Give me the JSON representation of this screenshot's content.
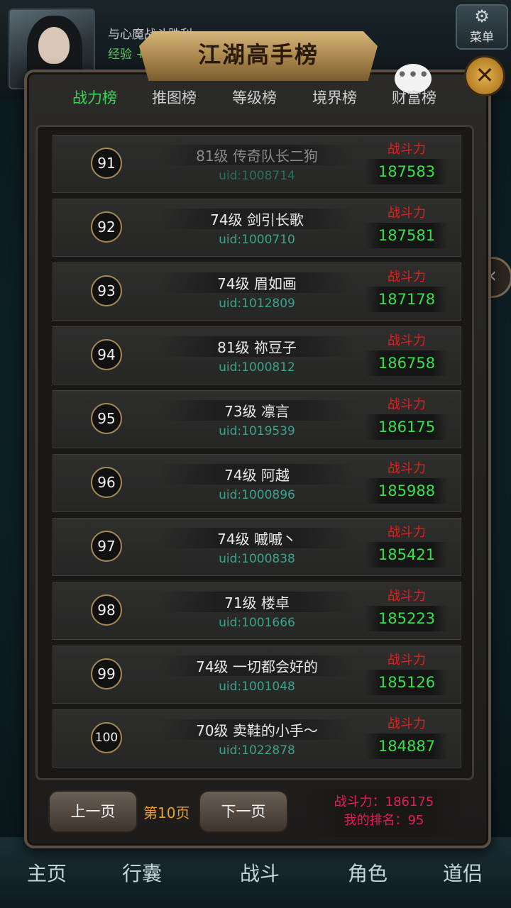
{
  "header": {
    "status": "与心魔战斗胜利",
    "exp": "经验 +",
    "menu_label": "菜单"
  },
  "panel": {
    "title": "江湖高手榜",
    "tabs": [
      {
        "label": "战力榜",
        "active": true
      },
      {
        "label": "推图榜",
        "active": false
      },
      {
        "label": "等级榜",
        "active": false
      },
      {
        "label": "境界榜",
        "active": false
      },
      {
        "label": "财富榜",
        "active": false
      }
    ],
    "power_label": "战斗力",
    "rows": [
      {
        "rank": "91",
        "name": "81级 传奇队长二狗",
        "uid": "uid:1008714",
        "power": "187583"
      },
      {
        "rank": "92",
        "name": "74级 剑引长歌",
        "uid": "uid:1000710",
        "power": "187581"
      },
      {
        "rank": "93",
        "name": "74级 眉如画",
        "uid": "uid:1012809",
        "power": "187178"
      },
      {
        "rank": "94",
        "name": "81级 祢豆子",
        "uid": "uid:1000812",
        "power": "186758"
      },
      {
        "rank": "95",
        "name": "73级 凛言",
        "uid": "uid:1019539",
        "power": "186175"
      },
      {
        "rank": "96",
        "name": "74级 阿越",
        "uid": "uid:1000896",
        "power": "185988"
      },
      {
        "rank": "97",
        "name": "74级 嘁嘁丶",
        "uid": "uid:1000838",
        "power": "185421"
      },
      {
        "rank": "98",
        "name": "71级 楼卓",
        "uid": "uid:1001666",
        "power": "185223"
      },
      {
        "rank": "99",
        "name": "74级 一切都会好的",
        "uid": "uid:1001048",
        "power": "185126"
      },
      {
        "rank": "100",
        "name": "70级 卖鞋的小手～",
        "uid": "uid:1022878",
        "power": "184887"
      }
    ],
    "prev_label": "上一页",
    "page_label": "第10页",
    "next_label": "下一页",
    "my_power": "战斗力：186175",
    "my_rank": "我的排名：95"
  },
  "bottom_nav": [
    "主页",
    "行囊",
    "战斗",
    "角色",
    "道侣"
  ],
  "colors": {
    "active_tab": "#3cd25a",
    "power_value": "#37e04a",
    "power_label": "#e02020",
    "uid": "#38a48e",
    "page": "#e8a02a"
  }
}
